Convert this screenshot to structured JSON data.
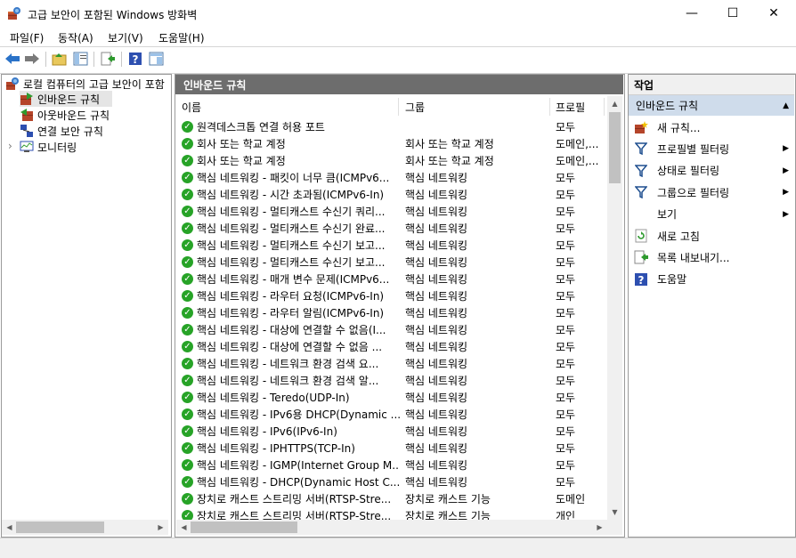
{
  "window": {
    "title": "고급 보안이 포함된 Windows 방화벽",
    "minimize": "—",
    "maximize": "☐",
    "close": "✕"
  },
  "menu": [
    "파일(F)",
    "동작(A)",
    "보기(V)",
    "도움말(H)"
  ],
  "tree": {
    "root": "로컬 컴퓨터의 고급 보안이 포함",
    "items": [
      "인바운드 규칙",
      "아웃바운드 규칙",
      "연결 보안 규칙",
      "모니터링"
    ],
    "expander": "›"
  },
  "main": {
    "header": "인바운드 규칙",
    "columns": [
      "이름",
      "그룹",
      "프로필"
    ],
    "rows": [
      {
        "name": "원격데스크톱 연결 허용 포트",
        "group": "",
        "profile": "모두"
      },
      {
        "name": "회사 또는 학교 계정",
        "group": "회사 또는 학교 계정",
        "profile": "도메인,..."
      },
      {
        "name": "회사 또는 학교 계정",
        "group": "회사 또는 학교 계정",
        "profile": "도메인,..."
      },
      {
        "name": "핵심 네트워킹 - 패킷이 너무 큼(ICMPv6...",
        "group": "핵심 네트워킹",
        "profile": "모두"
      },
      {
        "name": "핵심 네트워킹 - 시간 초과됨(ICMPv6-In)",
        "group": "핵심 네트워킹",
        "profile": "모두"
      },
      {
        "name": "핵심 네트워킹 - 멀티캐스트 수신기 쿼리...",
        "group": "핵심 네트워킹",
        "profile": "모두"
      },
      {
        "name": "핵심 네트워킹 - 멀티캐스트 수신기 완료...",
        "group": "핵심 네트워킹",
        "profile": "모두"
      },
      {
        "name": "핵심 네트워킹 - 멀티캐스트 수신기 보고...",
        "group": "핵심 네트워킹",
        "profile": "모두"
      },
      {
        "name": "핵심 네트워킹 - 멀티캐스트 수신기 보고...",
        "group": "핵심 네트워킹",
        "profile": "모두"
      },
      {
        "name": "핵심 네트워킹 - 매개 변수 문제(ICMPv6...",
        "group": "핵심 네트워킹",
        "profile": "모두"
      },
      {
        "name": "핵심 네트워킹 - 라우터 요청(ICMPv6-In)",
        "group": "핵심 네트워킹",
        "profile": "모두"
      },
      {
        "name": "핵심 네트워킹 - 라우터 알림(ICMPv6-In)",
        "group": "핵심 네트워킹",
        "profile": "모두"
      },
      {
        "name": "핵심 네트워킹 - 대상에 연결할 수 없음(I...",
        "group": "핵심 네트워킹",
        "profile": "모두"
      },
      {
        "name": "핵심 네트워킹 - 대상에 연결할 수 없음 ...",
        "group": "핵심 네트워킹",
        "profile": "모두"
      },
      {
        "name": "핵심 네트워킹 - 네트워크 환경 검색 요...",
        "group": "핵심 네트워킹",
        "profile": "모두"
      },
      {
        "name": "핵심 네트워킹 - 네트워크 환경 검색 알...",
        "group": "핵심 네트워킹",
        "profile": "모두"
      },
      {
        "name": "핵심 네트워킹 - Teredo(UDP-In)",
        "group": "핵심 네트워킹",
        "profile": "모두"
      },
      {
        "name": "핵심 네트워킹 - IPv6용 DHCP(Dynamic ...",
        "group": "핵심 네트워킹",
        "profile": "모두"
      },
      {
        "name": "핵심 네트워킹 - IPv6(IPv6-In)",
        "group": "핵심 네트워킹",
        "profile": "모두"
      },
      {
        "name": "핵심 네트워킹 - IPHTTPS(TCP-In)",
        "group": "핵심 네트워킹",
        "profile": "모두"
      },
      {
        "name": "핵심 네트워킹 - IGMP(Internet Group M...",
        "group": "핵심 네트워킹",
        "profile": "모두"
      },
      {
        "name": "핵심 네트워킹 - DHCP(Dynamic Host C...",
        "group": "핵심 네트워킹",
        "profile": "모두"
      },
      {
        "name": "장치로 캐스트 스트리밍 서버(RTSP-Stre...",
        "group": "장치로 캐스트 기능",
        "profile": "도메인"
      },
      {
        "name": "장치로 캐스트 스트리밍 서버(RTSP-Stre...",
        "group": "장치로 캐스트 기능",
        "profile": "개인"
      }
    ]
  },
  "actions": {
    "header": "작업",
    "section": "인바운드 규칙",
    "items": [
      {
        "label": "새 규칙...",
        "icon": "new-rule-icon",
        "submenu": false
      },
      {
        "label": "프로필별 필터링",
        "icon": "filter-icon",
        "submenu": true
      },
      {
        "label": "상태로 필터링",
        "icon": "filter-icon",
        "submenu": true
      },
      {
        "label": "그룹으로 필터링",
        "icon": "filter-icon",
        "submenu": true
      },
      {
        "label": "보기",
        "icon": "",
        "submenu": true
      },
      {
        "label": "새로 고침",
        "icon": "refresh-icon",
        "submenu": false
      },
      {
        "label": "목록 내보내기...",
        "icon": "export-list-icon",
        "submenu": false
      },
      {
        "label": "도움말",
        "icon": "help-icon",
        "submenu": false
      }
    ]
  },
  "colors": {
    "selection": "#cfdceb",
    "darkHeader": "#6d6d6d",
    "enabledGreen": "#27a327"
  }
}
